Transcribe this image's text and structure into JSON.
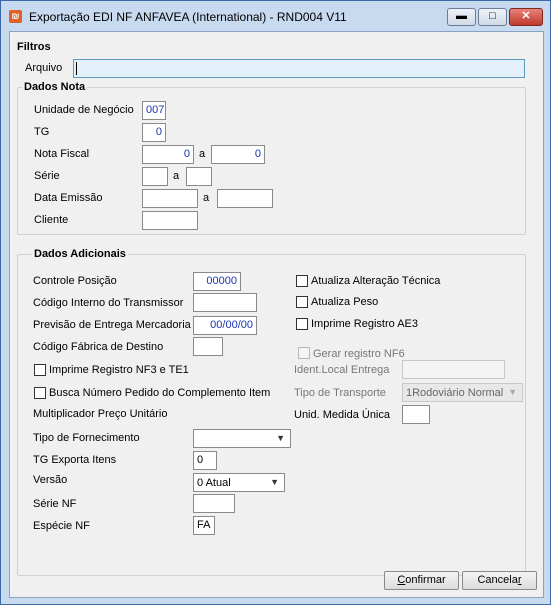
{
  "window": {
    "title": "Exportação EDI NF ANFAVEA (International) - RND004 V11",
    "icon": "app-icon",
    "min_symbol": "▬",
    "max_symbol": "□",
    "close_symbol": "✕"
  },
  "filtros": {
    "title": "Filtros",
    "arquivo_label": "Arquivo",
    "arquivo_value": ""
  },
  "dados_nota": {
    "title": "Dados Nota",
    "unidade_label": "Unidade de Negócio",
    "unidade_value": "007",
    "tg_label": "TG",
    "tg_value": "0",
    "nota_fiscal_label": "Nota Fiscal",
    "nota_fiscal_from": "0",
    "nota_fiscal_sep": "a",
    "nota_fiscal_to": "0",
    "serie_label": "Série",
    "serie_from": "",
    "serie_sep": "a",
    "serie_to": "",
    "data_emissao_label": "Data Emissão",
    "data_from": "",
    "data_sep": "a",
    "data_to": "",
    "cliente_label": "Cliente",
    "cliente_value": ""
  },
  "dados_adicionais": {
    "title": "Dados Adicionais",
    "controle_posicao_label": "Controle Posição",
    "controle_posicao_value": "00000",
    "codigo_transmissor_label": "Código Interno do Transmissor",
    "codigo_transmissor_value": "",
    "previsao_entrega_label": "Previsão de Entrega Mercadoria",
    "previsao_entrega_value": "00/00/00",
    "codigo_fabrica_label": "Código Fábrica de Destino",
    "codigo_fabrica_value": "",
    "imprime_nf3_label": "Imprime Registro NF3 e TE1",
    "busca_pedido_label": "Busca Número Pedido do Complemento Item",
    "multiplicador_label": "Multiplicador Preço Unitário",
    "tipo_fornecimento_label": "Tipo de Fornecimento",
    "tipo_fornecimento_value": "",
    "tg_exporta_label": "TG Exporta Itens",
    "tg_exporta_value": "0",
    "versao_label": "Versão",
    "versao_value": "0 Atual",
    "serie_nf_label": "Série NF",
    "serie_nf_value": "",
    "especie_nf_label": "Espécie NF",
    "especie_nf_value": "FA",
    "atualiza_alteracao_label": "Atualiza Alteração Técnica",
    "atualiza_peso_label": "Atualiza Peso",
    "imprime_ae3_label": "Imprime Registro AE3",
    "gerar_nf6_label": "Gerar registro NF6",
    "ident_local_label": "Ident.Local Entrega",
    "ident_local_value": "",
    "tipo_transporte_label": "Tipo de Transporte",
    "tipo_transporte_value": "1Rodoviário Normal",
    "unid_medida_label": "Unid. Medida Única",
    "unid_medida_value": ""
  },
  "buttons": {
    "confirmar_pre": "",
    "confirmar_u": "C",
    "confirmar_post": "onfirmar",
    "cancelar_pre": "Cancela",
    "cancelar_u": "r",
    "cancelar_post": ""
  },
  "icons": {
    "dropdown": "▼",
    "dropdown_icon": "chevron-down-icon"
  }
}
